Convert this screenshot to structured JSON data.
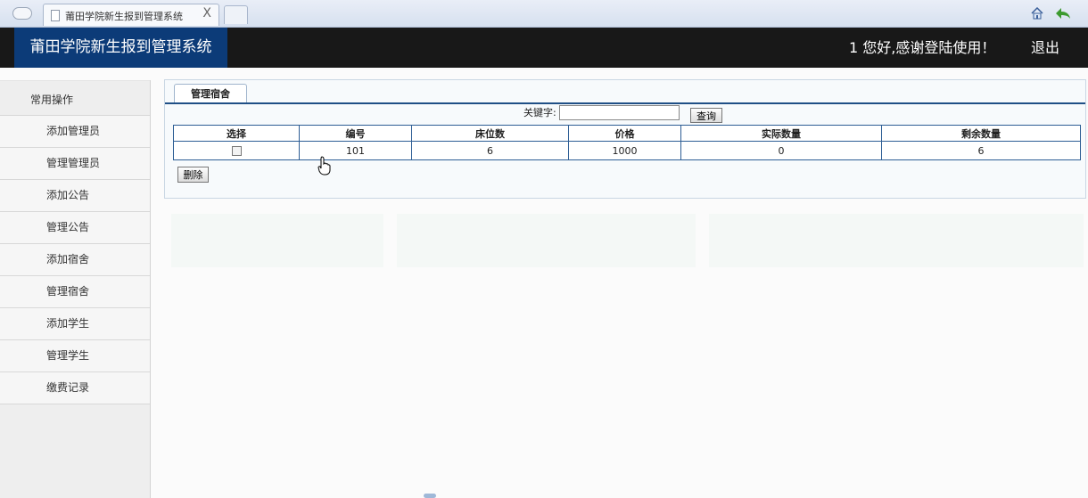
{
  "browser": {
    "tab_title": "莆田学院新生报到管理系统",
    "tab_close": "X"
  },
  "header": {
    "brand": "莆田学院新生报到管理系统",
    "welcome": "1 您好,感谢登陆使用！",
    "logout": "退出"
  },
  "sidebar": {
    "heading": "常用操作",
    "items": [
      {
        "label": "添加管理员"
      },
      {
        "label": "管理管理员"
      },
      {
        "label": "添加公告"
      },
      {
        "label": "管理公告"
      },
      {
        "label": "添加宿舍"
      },
      {
        "label": "管理宿舍"
      },
      {
        "label": "添加学生"
      },
      {
        "label": "管理学生"
      },
      {
        "label": "缴费记录"
      }
    ]
  },
  "main": {
    "tab_label": "管理宿舍",
    "search": {
      "label": "关键字:",
      "value": "",
      "button": "查询"
    },
    "table": {
      "headers": [
        "选择",
        "编号",
        "床位数",
        "价格",
        "实际数量",
        "剩余数量"
      ],
      "rows": [
        {
          "checked": false,
          "id": "101",
          "beds": "6",
          "price": "1000",
          "actual": "0",
          "remaining": "6"
        }
      ]
    },
    "delete_button": "删除"
  },
  "colors": {
    "header_bg": "#181818",
    "brand_bg": "#0c3b78",
    "table_border": "#2c5d94"
  }
}
